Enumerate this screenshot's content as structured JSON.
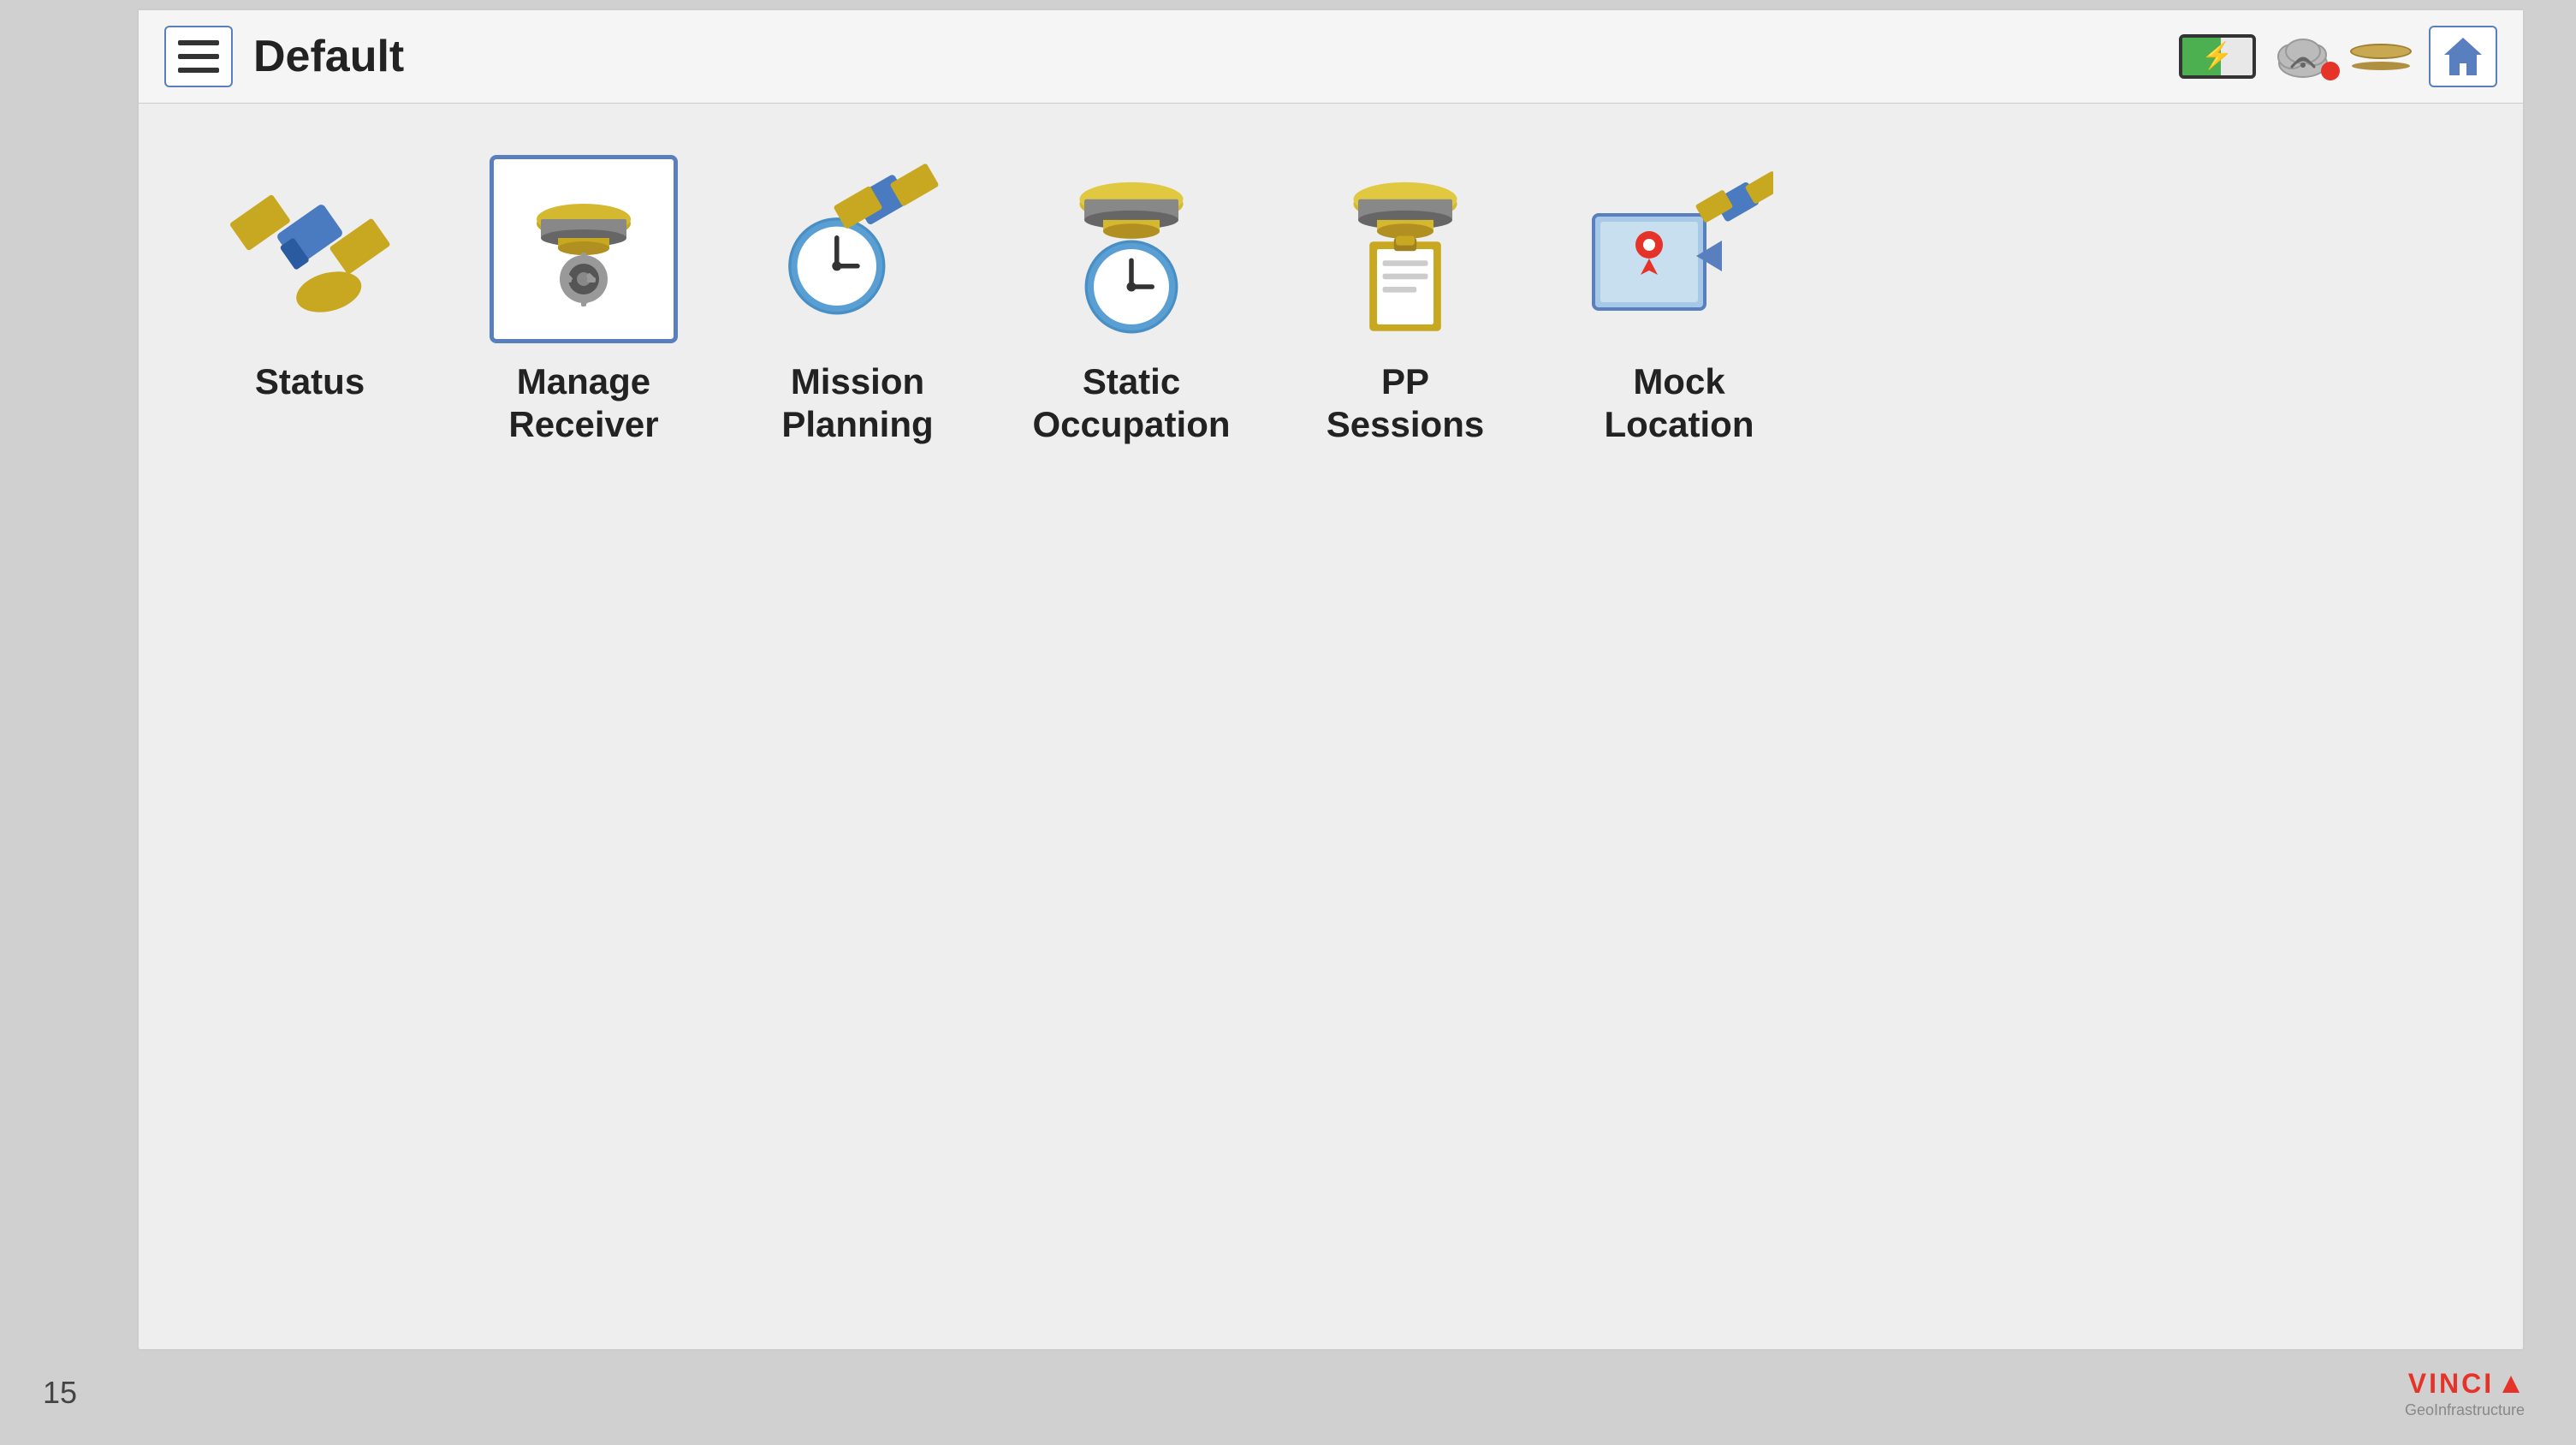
{
  "page": {
    "number": "15",
    "background_color": "#d0d0d0"
  },
  "header": {
    "title": "Default",
    "home_label": "home",
    "hamburger_label": "menu"
  },
  "menu": {
    "items": [
      {
        "id": "status",
        "label": "Status",
        "icon": "satellite-icon",
        "selected": false
      },
      {
        "id": "manage-receiver",
        "label": "Manage\nReceiver",
        "label_line1": "Manage",
        "label_line2": "Receiver",
        "icon": "receiver-gear-icon",
        "selected": true
      },
      {
        "id": "mission-planning",
        "label": "Mission\nPlanning",
        "label_line1": "Mission",
        "label_line2": "Planning",
        "icon": "satellite-clock-icon",
        "selected": false
      },
      {
        "id": "static-occupation",
        "label": "Static\nOccupation",
        "label_line1": "Static",
        "label_line2": "Occupation",
        "icon": "receiver-clock-icon",
        "selected": false
      },
      {
        "id": "pp-sessions",
        "label": "PP Sessions",
        "icon": "receiver-notebook-icon",
        "selected": false
      },
      {
        "id": "mock-location",
        "label": "Mock\nLocation",
        "label_line1": "Mock",
        "label_line2": "Location",
        "icon": "satellite-map-icon",
        "selected": false
      }
    ]
  },
  "logo": {
    "company": "VINCI",
    "division": "GeoInfrastructure"
  }
}
